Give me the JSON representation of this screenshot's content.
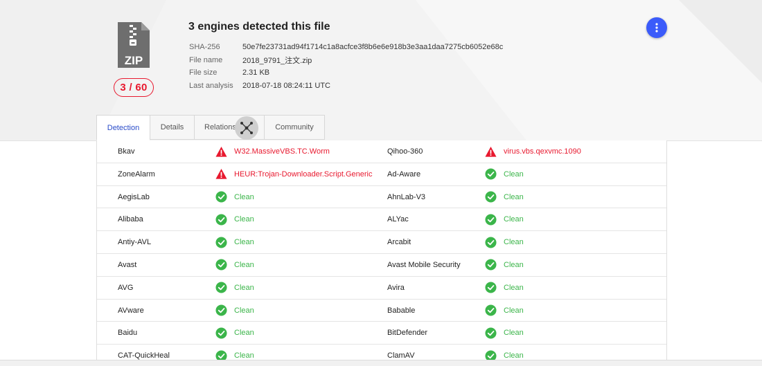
{
  "header": {
    "title": "3 engines detected this file",
    "file_type_label": "ZIP",
    "score": "3 / 60",
    "meta": [
      {
        "key": "SHA-256",
        "value": "50e7fe23731ad94f1714c1a8acfce3f8b6e6e918b3e3aa1daa7275cb6052e68c"
      },
      {
        "key": "File name",
        "value": "2018_9791_注文.zip"
      },
      {
        "key": "File size",
        "value": "2.31 KB"
      },
      {
        "key": "Last analysis",
        "value": "2018-07-18 08:24:11 UTC"
      }
    ]
  },
  "tabs": [
    {
      "label": "Detection",
      "active": true
    },
    {
      "label": "Details",
      "active": false
    },
    {
      "label": "Relations",
      "active": false
    },
    {
      "label": "Community",
      "active": false
    }
  ],
  "colors": {
    "accent": "#3b5bfa",
    "tab_active": "#2a4cc9",
    "malicious": "#e8182e",
    "clean": "#3bb54a"
  },
  "rows": [
    {
      "left": {
        "engine": "Bkav",
        "result": "W32.MassiveVBS.TC.Worm",
        "status": "malicious"
      },
      "right": {
        "engine": "Qihoo-360",
        "result": "virus.vbs.qexvmc.1090",
        "status": "malicious"
      }
    },
    {
      "left": {
        "engine": "ZoneAlarm",
        "result": "HEUR:Trojan-Downloader.Script.Generic",
        "status": "malicious"
      },
      "right": {
        "engine": "Ad-Aware",
        "result": "Clean",
        "status": "clean"
      }
    },
    {
      "left": {
        "engine": "AegisLab",
        "result": "Clean",
        "status": "clean"
      },
      "right": {
        "engine": "AhnLab-V3",
        "result": "Clean",
        "status": "clean"
      }
    },
    {
      "left": {
        "engine": "Alibaba",
        "result": "Clean",
        "status": "clean"
      },
      "right": {
        "engine": "ALYac",
        "result": "Clean",
        "status": "clean"
      }
    },
    {
      "left": {
        "engine": "Antiy-AVL",
        "result": "Clean",
        "status": "clean"
      },
      "right": {
        "engine": "Arcabit",
        "result": "Clean",
        "status": "clean"
      }
    },
    {
      "left": {
        "engine": "Avast",
        "result": "Clean",
        "status": "clean"
      },
      "right": {
        "engine": "Avast Mobile Security",
        "result": "Clean",
        "status": "clean"
      }
    },
    {
      "left": {
        "engine": "AVG",
        "result": "Clean",
        "status": "clean"
      },
      "right": {
        "engine": "Avira",
        "result": "Clean",
        "status": "clean"
      }
    },
    {
      "left": {
        "engine": "AVware",
        "result": "Clean",
        "status": "clean"
      },
      "right": {
        "engine": "Babable",
        "result": "Clean",
        "status": "clean"
      }
    },
    {
      "left": {
        "engine": "Baidu",
        "result": "Clean",
        "status": "clean"
      },
      "right": {
        "engine": "BitDefender",
        "result": "Clean",
        "status": "clean"
      }
    },
    {
      "left": {
        "engine": "CAT-QuickHeal",
        "result": "Clean",
        "status": "clean"
      },
      "right": {
        "engine": "ClamAV",
        "result": "Clean",
        "status": "clean"
      }
    }
  ]
}
